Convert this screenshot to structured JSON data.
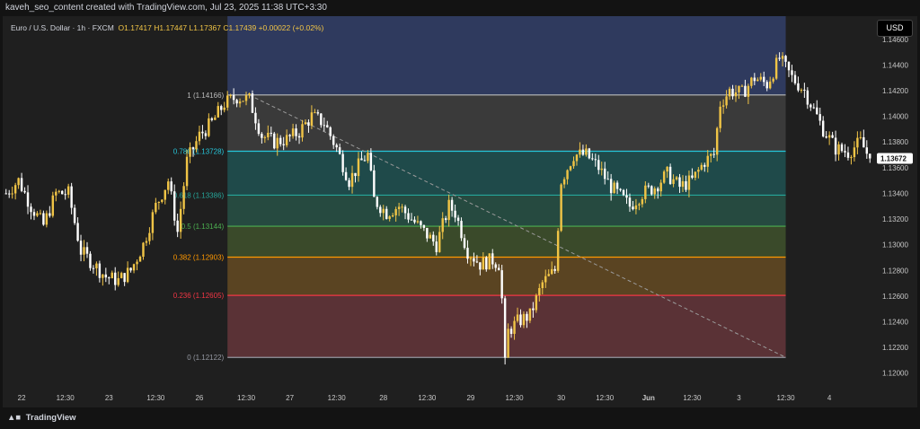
{
  "header": {
    "attribution": "kaveh_seo_content created with TradingView.com, Jul 23, 2025 11:38 UTC+3:30"
  },
  "legend": {
    "symbol": "Euro / U.S. Dollar · 1h · FXCM",
    "open": "O1.17417",
    "high": "H1.17447",
    "low": "L1.17367",
    "close": "C1.17439",
    "change": "+0.00022 (+0.02%)"
  },
  "currency_button": "USD",
  "footer": {
    "brand": "TradingView"
  },
  "colors": {
    "up": "#f0c446",
    "down": "#ffffff",
    "background": "#1f1f1f",
    "fib_1": "#bcbcbc",
    "fib_0786": "#26c6da",
    "fib_0618": "#26a69a",
    "fib_05": "#4caf50",
    "fib_0382": "#ff9800",
    "fib_0236": "#f23645",
    "fib_0": "#9598a1"
  },
  "chart_data": {
    "type": "candlestick",
    "symbol": "EURUSD",
    "timeframe": "1h",
    "ylim": [
      1.119,
      1.1478
    ],
    "y_ticks": [
      "1.14600",
      "1.14400",
      "1.14200",
      "1.14000",
      "1.13800",
      "1.13600",
      "1.13400",
      "1.13200",
      "1.13000",
      "1.12800",
      "1.12600",
      "1.12400",
      "1.12200",
      "1.12000"
    ],
    "x_ticks": [
      "22",
      "12:30",
      "23",
      "12:30",
      "26",
      "12:30",
      "27",
      "12:30",
      "28",
      "12:30",
      "29",
      "12:30",
      "30",
      "12:30",
      "Jun",
      "12:30",
      "3",
      "12:30",
      "4"
    ],
    "x_tick_index": [
      5,
      19,
      33,
      48,
      62,
      77,
      91,
      106,
      121,
      135,
      149,
      163,
      178,
      192,
      206,
      220,
      235,
      250,
      264
    ],
    "bar_count": 278,
    "last_price": "1.13672",
    "fib_retracement": {
      "start_index": 71,
      "end_index": 250,
      "levels": [
        {
          "ratio": "1",
          "label": "1 (1.14166)",
          "price": 1.14166
        },
        {
          "ratio": "0.786",
          "label": "0.786 (1.13728)",
          "price": 1.13728
        },
        {
          "ratio": "0.618",
          "label": "0.618 (1.13386)",
          "price": 1.13386
        },
        {
          "ratio": "0.5",
          "label": "0.5 (1.13144)",
          "price": 1.13144
        },
        {
          "ratio": "0.382",
          "label": "0.382 (1.12903)",
          "price": 1.12903
        },
        {
          "ratio": "0.236",
          "label": "0.236 (1.12605)",
          "price": 1.12605
        },
        {
          "ratio": "0",
          "label": "0 (1.12122)",
          "price": 1.12122
        }
      ],
      "trend_line": {
        "from": {
          "index": 78,
          "price": 1.14166
        },
        "to": {
          "index": 250,
          "price": 1.12122
        }
      }
    },
    "price_path": [
      [
        0,
        1.134
      ],
      [
        4,
        1.135
      ],
      [
        8,
        1.133
      ],
      [
        12,
        1.1315
      ],
      [
        16,
        1.134
      ],
      [
        20,
        1.134
      ],
      [
        24,
        1.1295
      ],
      [
        28,
        1.1285
      ],
      [
        32,
        1.1275
      ],
      [
        36,
        1.1272
      ],
      [
        40,
        1.128
      ],
      [
        44,
        1.13
      ],
      [
        48,
        1.133
      ],
      [
        52,
        1.135
      ],
      [
        55,
        1.131
      ],
      [
        58,
        1.1365
      ],
      [
        62,
        1.1385
      ],
      [
        66,
        1.1395
      ],
      [
        70,
        1.141
      ],
      [
        74,
        1.1415
      ],
      [
        78,
        1.1413
      ],
      [
        82,
        1.1385
      ],
      [
        86,
        1.138
      ],
      [
        90,
        1.1382
      ],
      [
        94,
        1.1388
      ],
      [
        98,
        1.14
      ],
      [
        102,
        1.1395
      ],
      [
        106,
        1.1375
      ],
      [
        110,
        1.135
      ],
      [
        114,
        1.1365
      ],
      [
        116,
        1.137
      ],
      [
        118,
        1.1335
      ],
      [
        122,
        1.1325
      ],
      [
        126,
        1.133
      ],
      [
        130,
        1.132
      ],
      [
        134,
        1.131
      ],
      [
        138,
        1.13
      ],
      [
        142,
        1.133
      ],
      [
        144,
        1.1325
      ],
      [
        148,
        1.1295
      ],
      [
        152,
        1.1285
      ],
      [
        156,
        1.1288
      ],
      [
        158,
        1.1285
      ],
      [
        160,
        1.123
      ],
      [
        164,
        1.124
      ],
      [
        168,
        1.1245
      ],
      [
        172,
        1.127
      ],
      [
        176,
        1.128
      ],
      [
        178,
        1.135
      ],
      [
        182,
        1.137
      ],
      [
        186,
        1.137
      ],
      [
        190,
        1.136
      ],
      [
        194,
        1.1345
      ],
      [
        198,
        1.1335
      ],
      [
        200,
        1.133
      ],
      [
        204,
        1.134
      ],
      [
        208,
        1.1345
      ],
      [
        212,
        1.1355
      ],
      [
        216,
        1.1345
      ],
      [
        220,
        1.135
      ],
      [
        224,
        1.1365
      ],
      [
        227,
        1.137
      ],
      [
        229,
        1.141
      ],
      [
        232,
        1.142
      ],
      [
        236,
        1.1418
      ],
      [
        240,
        1.143
      ],
      [
        244,
        1.1425
      ],
      [
        248,
        1.1445
      ],
      [
        252,
        1.143
      ],
      [
        256,
        1.142
      ],
      [
        258,
        1.141
      ],
      [
        262,
        1.139
      ],
      [
        266,
        1.1375
      ],
      [
        270,
        1.1372
      ],
      [
        274,
        1.138
      ],
      [
        277,
        1.1367
      ]
    ]
  }
}
